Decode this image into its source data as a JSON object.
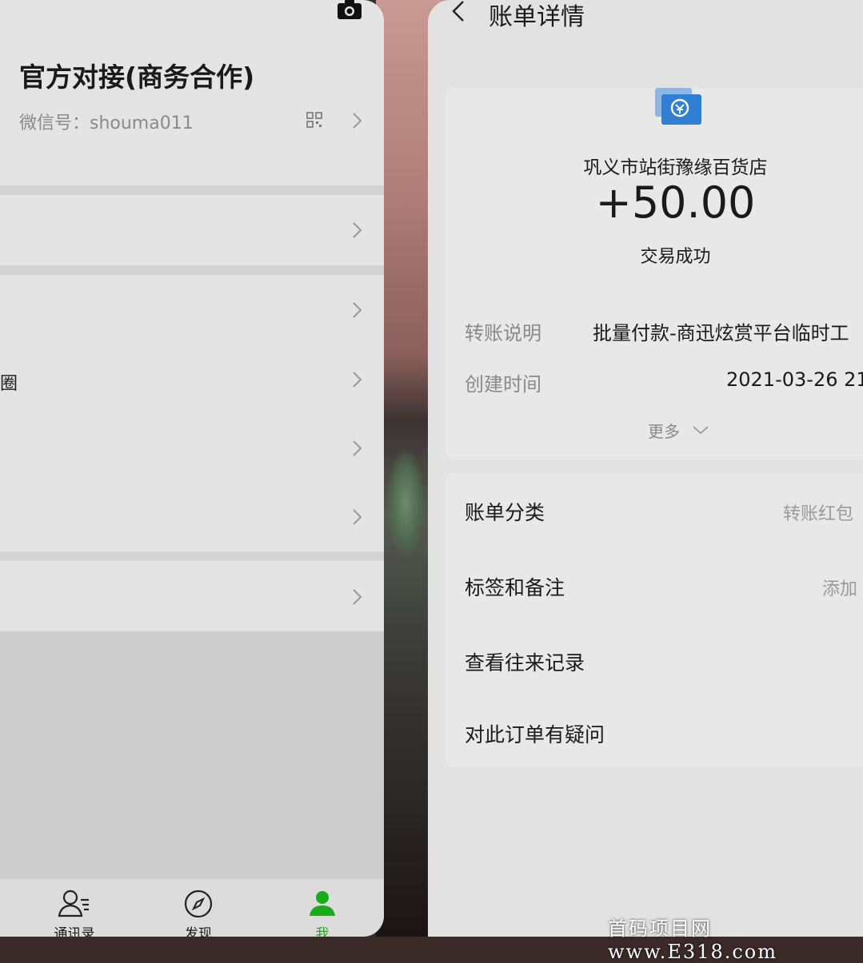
{
  "left": {
    "profile": {
      "name": "官方对接(商务合作)",
      "wechat_id": "微信号：shouma011"
    },
    "rows": {
      "moments_partial": "圈"
    },
    "nav": [
      {
        "label": "通讯录",
        "icon": "contacts-icon"
      },
      {
        "label": "发现",
        "icon": "compass-icon"
      },
      {
        "label": "我",
        "icon": "person-icon"
      }
    ],
    "colors": {
      "accent": "#1aad19"
    }
  },
  "right": {
    "header": {
      "title": "账单详情"
    },
    "bill": {
      "payee": "巩义市站街豫缘百货店",
      "amount": "+50.00",
      "status": "交易成功",
      "details": [
        {
          "label": "转账说明",
          "value": "批量付款-商迅炫赏平台临时工"
        },
        {
          "label": "创建时间",
          "value": "2021-03-26 21:"
        }
      ],
      "more": "更多"
    },
    "list": [
      {
        "label": "账单分类",
        "value": "转账红包"
      },
      {
        "label": "标签和备注",
        "value": "添加"
      },
      {
        "label": "查看往来记录",
        "value": ""
      },
      {
        "label": "对此订单有疑问",
        "value": ""
      }
    ]
  },
  "watermark": "首码项目网 www.E318.com"
}
